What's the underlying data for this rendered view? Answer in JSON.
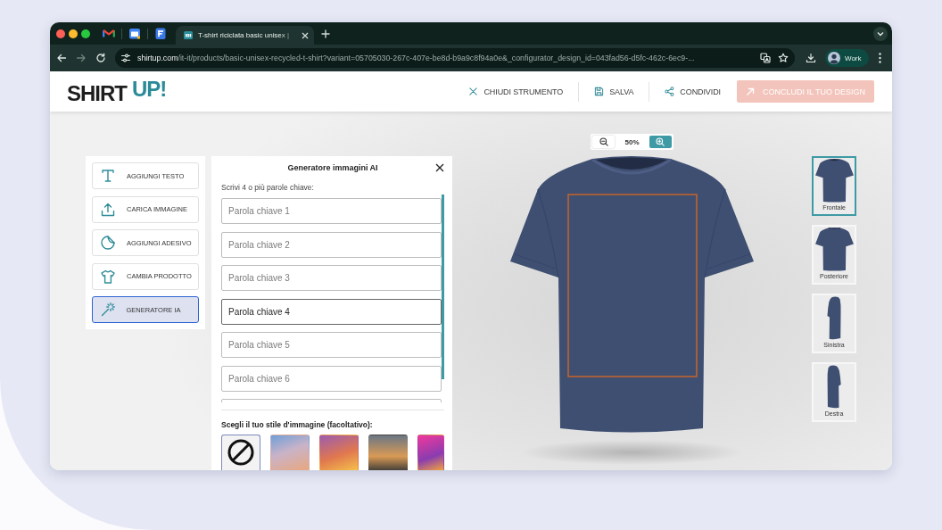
{
  "browser": {
    "tabs": [
      {
        "kind": "mail",
        "selected": false
      },
      {
        "kind": "calendar",
        "selected": false
      },
      {
        "kind": "document",
        "selected": false
      },
      {
        "kind": "page",
        "title": "T-shirt riciclata basic unisex |",
        "selected": true
      }
    ],
    "nav": [
      {
        "kind": "back",
        "disabled": false
      },
      {
        "kind": "forward",
        "disabled": true
      },
      {
        "kind": "reload",
        "disabled": false
      }
    ],
    "address": {
      "host": "shirtup.com",
      "path": "/it-it/products/basic-unisex-recycled-t-shirt?variant=05705030-267c-407e-be8d-b9a9c8f94a0e&_configurator_design_id=043fad56-d5fc-462c-6ec9-..."
    },
    "profile": {
      "label": "Work"
    }
  },
  "header": {
    "logo": {
      "text": "SHIRT",
      "accent": "UP!"
    },
    "actions": [
      {
        "kind": "close",
        "label": "CHIUDI STRUMENTO"
      },
      {
        "kind": "save",
        "label": "SALVA"
      },
      {
        "kind": "share",
        "label": "CONDIVIDI"
      }
    ],
    "primary_button": {
      "label": "CONCLUDI IL TUO DESIGN",
      "disabled": true
    }
  },
  "tools": [
    {
      "kind": "text",
      "label": "AGGIUNGI TESTO",
      "selected": false
    },
    {
      "kind": "upload",
      "label": "CARICA IMMAGINE",
      "selected": false
    },
    {
      "kind": "sticker",
      "label": "AGGIUNGI ADESIVO",
      "selected": false
    },
    {
      "kind": "product",
      "label": "CAMBIA PRODOTTO",
      "selected": false
    },
    {
      "kind": "ai",
      "label": "GENERATORE IA",
      "selected": true
    }
  ],
  "ai_panel": {
    "title": "Generatore immagini AI",
    "prompt_label": "Scrivi 4 o più parole chiave:",
    "keywords": [
      {
        "placeholder": "Parola chiave 1",
        "focused": false
      },
      {
        "placeholder": "Parola chiave 2",
        "focused": false
      },
      {
        "placeholder": "Parola chiave 3",
        "focused": false
      },
      {
        "placeholder": "Parola chiave 4",
        "focused": true
      },
      {
        "placeholder": "Parola chiave 5",
        "focused": false
      },
      {
        "placeholder": "Parola chiave 6",
        "focused": false
      },
      {
        "focused": false
      }
    ],
    "style_label": "Scegli il tuo stile d'immagine (facoltativo):",
    "styles": [
      {
        "kind": "none",
        "selected": true
      },
      {
        "kind": "image",
        "selected": false
      },
      {
        "kind": "image",
        "selected": false
      },
      {
        "kind": "image",
        "selected": false
      },
      {
        "kind": "image",
        "selected": false
      }
    ]
  },
  "canvas": {
    "zoom": "50%"
  },
  "views": [
    {
      "kind": "front",
      "label": "Frontale",
      "selected": true
    },
    {
      "kind": "back",
      "label": "Posteriore",
      "selected": false
    },
    {
      "kind": "left",
      "label": "Sinistra",
      "selected": false
    },
    {
      "kind": "right",
      "label": "Destra",
      "selected": false
    }
  ]
}
